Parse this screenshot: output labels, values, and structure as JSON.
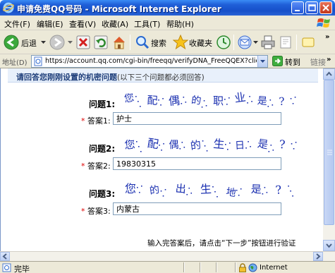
{
  "window": {
    "title": "申请免费QQ号码 - Microsoft Internet Explorer"
  },
  "menu": {
    "items": [
      "文件(F)",
      "编辑(E)",
      "查看(V)",
      "收藏(A)",
      "工具(T)",
      "帮助(H)"
    ]
  },
  "toolbar": {
    "back_label": "后退",
    "search_label": "搜索",
    "favorites_label": "收藏夹"
  },
  "address": {
    "label": "地址(D)",
    "url": "https://account.qq.com/cgi-bin/freeqq/verifyDNA_FreeQQEX?clientui",
    "go_label": "转到",
    "links_label": "链接"
  },
  "form": {
    "header_title": "请回答您刚刚设置的机密问题",
    "header_note": "(以下三个问题都必须回答)",
    "questions": [
      {
        "label": "问题1:",
        "captcha": [
          "您",
          "配",
          "偶",
          "的",
          "职",
          "业",
          "是",
          "?"
        ],
        "answer_label": "答案1:",
        "answer": "护士"
      },
      {
        "label": "问题2:",
        "captcha": [
          "您",
          "配",
          "偶",
          "的",
          "生",
          "日",
          "是",
          "?"
        ],
        "answer_label": "答案2:",
        "answer": "19830315"
      },
      {
        "label": "问题3:",
        "captcha": [
          "您",
          "的",
          "出",
          "生",
          "地",
          "是",
          "?"
        ],
        "answer_label": "答案3:",
        "answer": "内蒙古"
      }
    ],
    "required_mark": "*",
    "footer_note": "输入完答案后，请点击“下一步”按钮进行验证"
  },
  "status": {
    "text": "完毕",
    "zone": "Internet"
  },
  "colors": {
    "title_bar": "#1f5fd8",
    "captcha_ink": "#1a2fb0",
    "required": "#dd0000"
  }
}
